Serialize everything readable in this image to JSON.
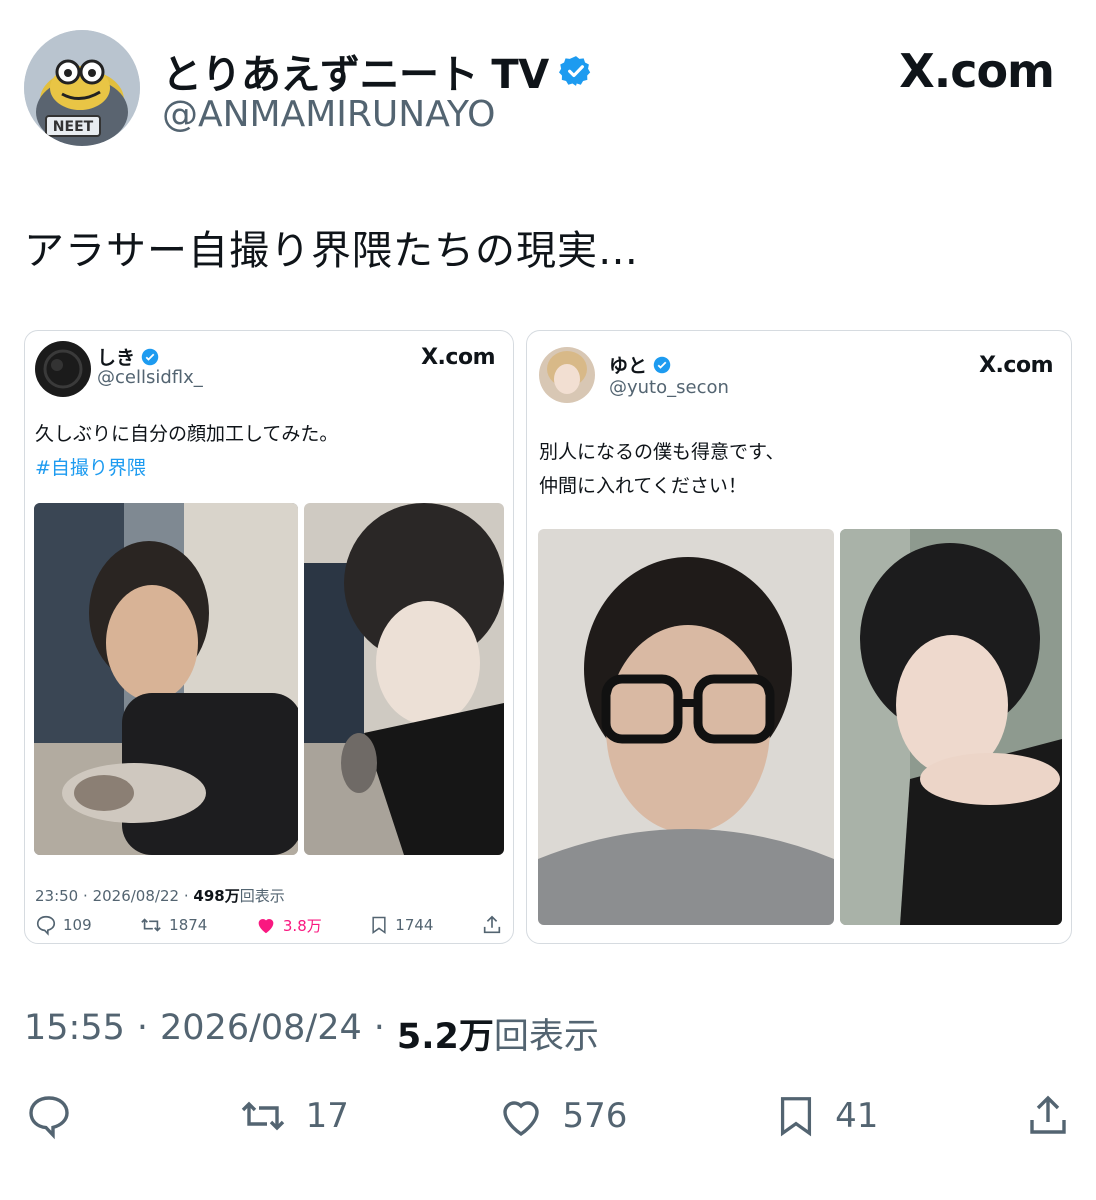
{
  "author": {
    "name": "とりあえずニート TV",
    "handle": "@ANMAMIRUNAYO",
    "avatar_label": "NEET"
  },
  "brand": "X.com",
  "tweet": {
    "text": "アラサー自撮り界隈たちの現実…",
    "time": "15:55",
    "separator1": "·",
    "date": "2026/08/24",
    "separator2": "·",
    "views_count": "5.2万",
    "views_label": "回表示",
    "stats": {
      "replies": "",
      "retweets": "17",
      "likes": "576",
      "bookmarks": "41"
    }
  },
  "quote_left": {
    "name": "しき",
    "handle": "@cellsidflx_",
    "brand": "X.com",
    "text": "久しぶりに自分の顔加工してみた。",
    "hashtag": "#自撮り界隈",
    "time": "23:50",
    "separator": "·",
    "date": "2026/08/22",
    "views_count": "498万",
    "views_label": "回表示",
    "stats": {
      "replies": "109",
      "retweets": "1874",
      "likes": "3.8万",
      "bookmarks": "1744"
    }
  },
  "quote_right": {
    "name": "ゆと",
    "handle": "@yuto_secon",
    "brand": "X.com",
    "text_line1": "別人になるの僕も得意です、",
    "text_line2": "仲間に入れてください！"
  },
  "colors": {
    "accent": "#1d9bf0",
    "secondary_text": "#536471",
    "primary_text": "#0f1419",
    "like_pink": "#f91880"
  },
  "icons": [
    "verified-badge-icon",
    "reply-icon",
    "retweet-icon",
    "like-icon",
    "bookmark-icon",
    "share-icon"
  ]
}
